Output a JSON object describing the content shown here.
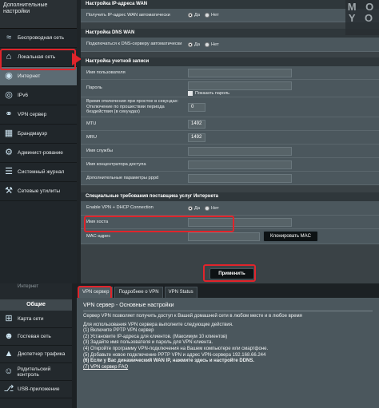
{
  "top": {
    "sidebar": {
      "header": "Дополнительные настройки",
      "items": [
        {
          "label": "Беспроводная сеть",
          "icon": "wifi-icon"
        },
        {
          "label": "Локальная сеть",
          "icon": "home-icon"
        },
        {
          "label": "Интернет",
          "icon": "globe-icon",
          "active": true
        },
        {
          "label": "IPv6",
          "icon": "ipv6-icon"
        },
        {
          "label": "VPN сервер",
          "icon": "vpn-icon"
        },
        {
          "label": "Брандмауэр",
          "icon": "firewall-icon"
        },
        {
          "label": "Админист-рование",
          "icon": "admin-icon"
        },
        {
          "label": "Системный журнал",
          "icon": "log-icon"
        },
        {
          "label": "Сетевые утилиты",
          "icon": "tools-icon"
        }
      ]
    },
    "sections": {
      "wan_ip": {
        "title": "Настройка IP-адреса WAN",
        "row_label": "Получить IP-адрес WAN автоматически",
        "yes": "Да",
        "no": "Нет"
      },
      "dns": {
        "title": "Настройка DNS WAN",
        "row_label": "Подключаться к DNS-серверу автоматически",
        "yes": "Да",
        "no": "Нет"
      },
      "account": {
        "title": "Настройка учетной записи",
        "username": "Имя пользователя",
        "password": "Пароль",
        "show_password": "Показать пароль",
        "idle_label": "Время отключения при простое в секундах: Отключение по прошествии периода бездействия (в секундах)",
        "idle_value": "0",
        "mtu": "MTU",
        "mtu_value": "1492",
        "mru": "MRU",
        "mru_value": "1492",
        "service_name": "Имя службы",
        "concentrator": "Имя концентратора доступа",
        "pppd_params": "Дополнительные параметры pppd"
      },
      "isp": {
        "title": "Специальные требования поставщика услуг Интернета",
        "vpn_dhcp": "Enable VPN + DHCP Connection",
        "yes": "Да",
        "no": "Нет",
        "hostname": "Имя хоста",
        "mac": "MAC-адрес",
        "clone_mac": "Клонировать MAC"
      }
    },
    "apply": "Применить"
  },
  "watermark": "M O Y O",
  "bottom": {
    "sidebar": {
      "header": "Интернет",
      "general": "Общие",
      "items": [
        {
          "label": "Карта сети",
          "icon": "network-map-icon"
        },
        {
          "label": "Гостевая сеть",
          "icon": "guest-network-icon"
        },
        {
          "label": "Диспетчер трафика",
          "icon": "traffic-manager-icon"
        },
        {
          "label": "Родительский контроль",
          "icon": "parental-control-icon"
        },
        {
          "label": "USB-приложение",
          "icon": "usb-icon"
        }
      ]
    },
    "tabs": [
      "VPN сервер",
      "Подробнее о VPN",
      "VPN Status"
    ],
    "panel": {
      "title": "VPN сервер - Основные настройки",
      "lines": [
        "Сервер VPN позволяет получить доступ к Вашей домашней сети в любом месте и в любое время",
        "Для использования VPN сервера выполните следующие действия.",
        "(1) Включите PPTP VPN сервер",
        "(2) Установите IP-адреса для клиентов. (Максимум 10 клиентов)",
        "(3) Задайте имя пользователя и пароль для VPN клиента.",
        "(4) Откройте программу VPN-подключения на Вашем компьютере или смартфоне.",
        "(5) Добавьте новое подключение PPTP VPN и адрес VPN-сервера 192.168.66.244"
      ],
      "bold_line": "(6) Если у Вас динамический WAN IP, нажмите здесь и настройте DDNS.",
      "faq": "(7) VPN сервер FAQ"
    }
  }
}
